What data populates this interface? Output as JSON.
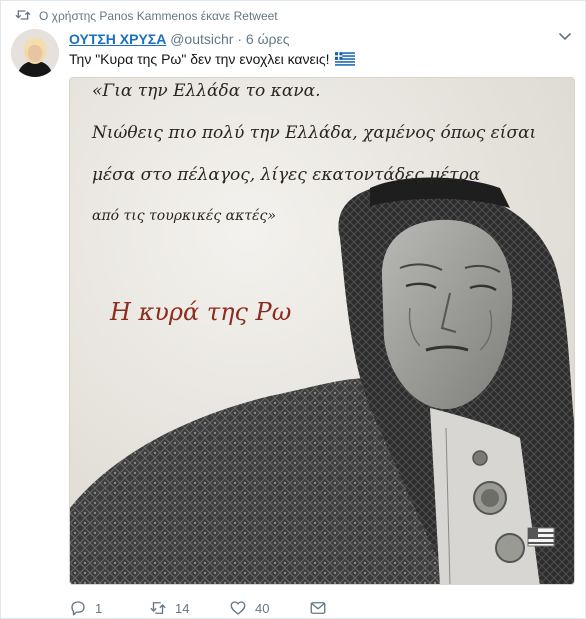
{
  "retweet_line": {
    "text": "Ο χρήστης Panos Kammenos έκανε Retweet"
  },
  "tweet": {
    "author_name": "ΟΥΤΣΗ ΧΡΥΣΑ",
    "handle": "@outsichr",
    "separator": "·",
    "time": "6 ώρες",
    "text": "Την \"Κυρα της Ρω\" δεν την ενοχλει κανεις!"
  },
  "image_caption": {
    "line1": "«Για την Ελλάδα το κανα.",
    "line2": "Νιώθεις πιο πολύ την Ελλάδα, χαμένος όπως είσαι",
    "line3": "μέσα στο πέλαγος, λίγες εκατοντάδες μέτρα",
    "line4": "από τις τουρκικές ακτές»",
    "title": "Η κυρά της Ρω"
  },
  "actions": {
    "reply_count": "1",
    "retweet_count": "14",
    "like_count": "40"
  },
  "colors": {
    "link_blue": "#1b6fc4",
    "muted": "#657786",
    "caption_ink": "#2a2520",
    "title_red": "#8c2b1e",
    "paper": "#f0ede8"
  },
  "icons": [
    "retweet-icon",
    "chevron-down-icon",
    "greek-flag-icon",
    "reply-icon",
    "like-icon",
    "direct-message-icon"
  ]
}
